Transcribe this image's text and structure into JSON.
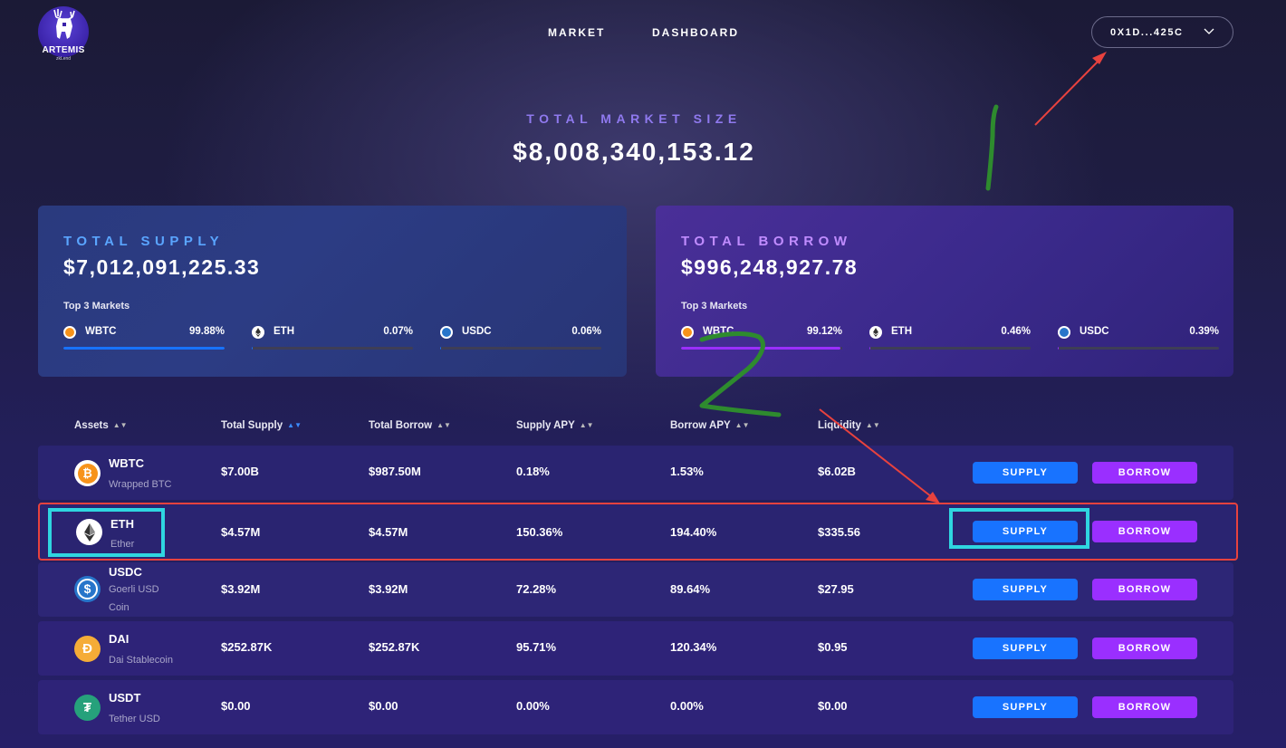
{
  "header": {
    "logo_text": "ARTEMIS",
    "logo_sub": "zkLend",
    "nav": [
      "MARKET",
      "DASHBOARD"
    ],
    "wallet": "0X1D...425C"
  },
  "market": {
    "label": "TOTAL MARKET SIZE",
    "value": "$8,008,340,153.12"
  },
  "supply": {
    "title": "TOTAL SUPPLY",
    "value": "$7,012,091,225.33",
    "top3_label": "Top 3 Markets",
    "markets": [
      {
        "name": "WBTC",
        "pct": "99.88%",
        "fill": 99.88
      },
      {
        "name": "ETH",
        "pct": "0.07%",
        "fill": 0.07
      },
      {
        "name": "USDC",
        "pct": "0.06%",
        "fill": 0.06
      }
    ]
  },
  "borrow": {
    "title": "TOTAL BORROW",
    "value": "$996,248,927.78",
    "top3_label": "Top 3 Markets",
    "markets": [
      {
        "name": "WBTC",
        "pct": "99.12%",
        "fill": 99.12
      },
      {
        "name": "ETH",
        "pct": "0.46%",
        "fill": 0.46
      },
      {
        "name": "USDC",
        "pct": "0.39%",
        "fill": 0.39
      }
    ]
  },
  "table": {
    "headers": [
      "Assets",
      "Total Supply",
      "Total Borrow",
      "Supply APY",
      "Borrow APY",
      "Liquidity"
    ],
    "supply_label": "SUPPLY",
    "borrow_label": "BORROW",
    "rows": [
      {
        "symbol": "WBTC",
        "name": "Wrapped BTC",
        "total_supply": "$7.00B",
        "total_borrow": "$987.50M",
        "supply_apy": "0.18%",
        "borrow_apy": "1.53%",
        "liquidity": "$6.02B"
      },
      {
        "symbol": "ETH",
        "name": "Ether",
        "total_supply": "$4.57M",
        "total_borrow": "$4.57M",
        "supply_apy": "150.36%",
        "borrow_apy": "194.40%",
        "liquidity": "$335.56"
      },
      {
        "symbol": "USDC",
        "name": "Goerli USD Coin",
        "total_supply": "$3.92M",
        "total_borrow": "$3.92M",
        "supply_apy": "72.28%",
        "borrow_apy": "89.64%",
        "liquidity": "$27.95"
      },
      {
        "symbol": "DAI",
        "name": "Dai Stablecoin",
        "total_supply": "$252.87K",
        "total_borrow": "$252.87K",
        "supply_apy": "95.71%",
        "borrow_apy": "120.34%",
        "liquidity": "$0.95"
      },
      {
        "symbol": "USDT",
        "name": "Tether USD",
        "total_supply": "$0.00",
        "total_borrow": "$0.00",
        "supply_apy": "0.00%",
        "borrow_apy": "0.00%",
        "liquidity": "$0.00"
      }
    ]
  },
  "annotations": {
    "mark_1": "1",
    "mark_2": "2"
  },
  "colors": {
    "supply_accent": "#1873ff",
    "borrow_accent": "#9a2fff",
    "highlight_red": "#e8423e",
    "highlight_cyan": "#2fd6e0",
    "annotation_green": "#2e8b2e"
  }
}
